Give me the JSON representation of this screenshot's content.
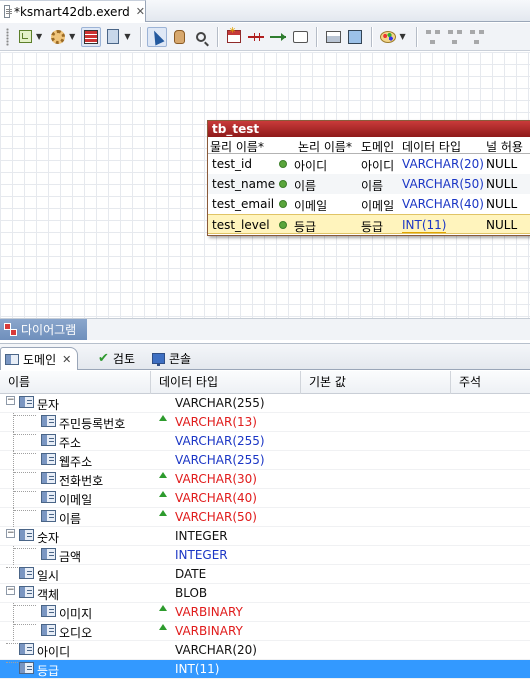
{
  "editor": {
    "tab_title": "*ksmart42db.exerd",
    "close_glyph": "✕"
  },
  "toolbar": {
    "icons": [
      "layer-icon",
      "settings-icon",
      "grid-icon",
      "clipboard-icon",
      "select-arrow-icon",
      "hand-icon",
      "zoom-icon",
      "new-table-icon",
      "relation-icon",
      "identifying-relation-icon",
      "note-icon",
      "print-icon",
      "export-icon",
      "palette-icon",
      "align-icon"
    ]
  },
  "diagram": {
    "table": {
      "name": "tb_test",
      "headers": [
        "물리 이름*",
        "논리 이름*",
        "도메인",
        "데이터 타입",
        "널 허용"
      ],
      "rows": [
        {
          "physical": "test_id",
          "logical": "아이디",
          "domain": "아이디",
          "type": "VARCHAR(20)",
          "null": "NULL"
        },
        {
          "physical": "test_name",
          "logical": "이름",
          "domain": "이름",
          "type": "VARCHAR(50)",
          "null": "NULL"
        },
        {
          "physical": "test_email",
          "logical": "이메일",
          "domain": "이메일",
          "type": "VARCHAR(40)",
          "null": "NULL"
        },
        {
          "physical": "test_level",
          "logical": "등급",
          "domain": "등급",
          "type": "INT(11)",
          "null": "NULL"
        }
      ]
    },
    "bottom_tab": "다이어그램"
  },
  "view": {
    "tabs": [
      {
        "label": "도메인",
        "icon": "domain-icon",
        "close": "✕"
      },
      {
        "label": "검토",
        "icon": "check-icon"
      },
      {
        "label": "콘솔",
        "icon": "console-icon"
      }
    ],
    "columns": [
      "이름",
      "데이터 타입",
      "기본 값",
      "주석"
    ],
    "rows": [
      {
        "name": "문자",
        "type": "VARCHAR(255)",
        "color": "black",
        "level": 0,
        "expander": "−",
        "flag": false
      },
      {
        "name": "주민등록번호",
        "type": "VARCHAR(13)",
        "color": "red",
        "level": 1,
        "flag": true
      },
      {
        "name": "주소",
        "type": "VARCHAR(255)",
        "color": "blue",
        "level": 1,
        "flag": false
      },
      {
        "name": "웹주소",
        "type": "VARCHAR(255)",
        "color": "blue",
        "level": 1,
        "flag": false
      },
      {
        "name": "전화번호",
        "type": "VARCHAR(30)",
        "color": "red",
        "level": 1,
        "flag": true
      },
      {
        "name": "이메일",
        "type": "VARCHAR(40)",
        "color": "red",
        "level": 1,
        "flag": true
      },
      {
        "name": "이름",
        "type": "VARCHAR(50)",
        "color": "red",
        "level": 1,
        "flag": true
      },
      {
        "name": "숫자",
        "type": "INTEGER",
        "color": "black",
        "level": 0,
        "expander": "−",
        "flag": false
      },
      {
        "name": "금액",
        "type": "INTEGER",
        "color": "blue",
        "level": 1,
        "flag": false
      },
      {
        "name": "일시",
        "type": "DATE",
        "color": "black",
        "level": 0,
        "flag": false
      },
      {
        "name": "객체",
        "type": "BLOB",
        "color": "black",
        "level": 0,
        "expander": "−",
        "flag": false
      },
      {
        "name": "이미지",
        "type": "VARBINARY",
        "color": "red",
        "level": 1,
        "flag": true
      },
      {
        "name": "오디오",
        "type": "VARBINARY",
        "color": "red",
        "level": 1,
        "flag": true
      },
      {
        "name": "아이디",
        "type": "VARCHAR(20)",
        "color": "black",
        "level": 0,
        "flag": false
      },
      {
        "name": "등급",
        "type": "INT(11)",
        "color": "black",
        "level": 0,
        "flag": false,
        "selected": true
      }
    ]
  },
  "colors": {
    "table_header": "#b02828",
    "datatype_blue": "#1b36c5",
    "override_red": "#e01b1b",
    "selection": "#3399ff",
    "flag_green": "#2d9b2d"
  }
}
